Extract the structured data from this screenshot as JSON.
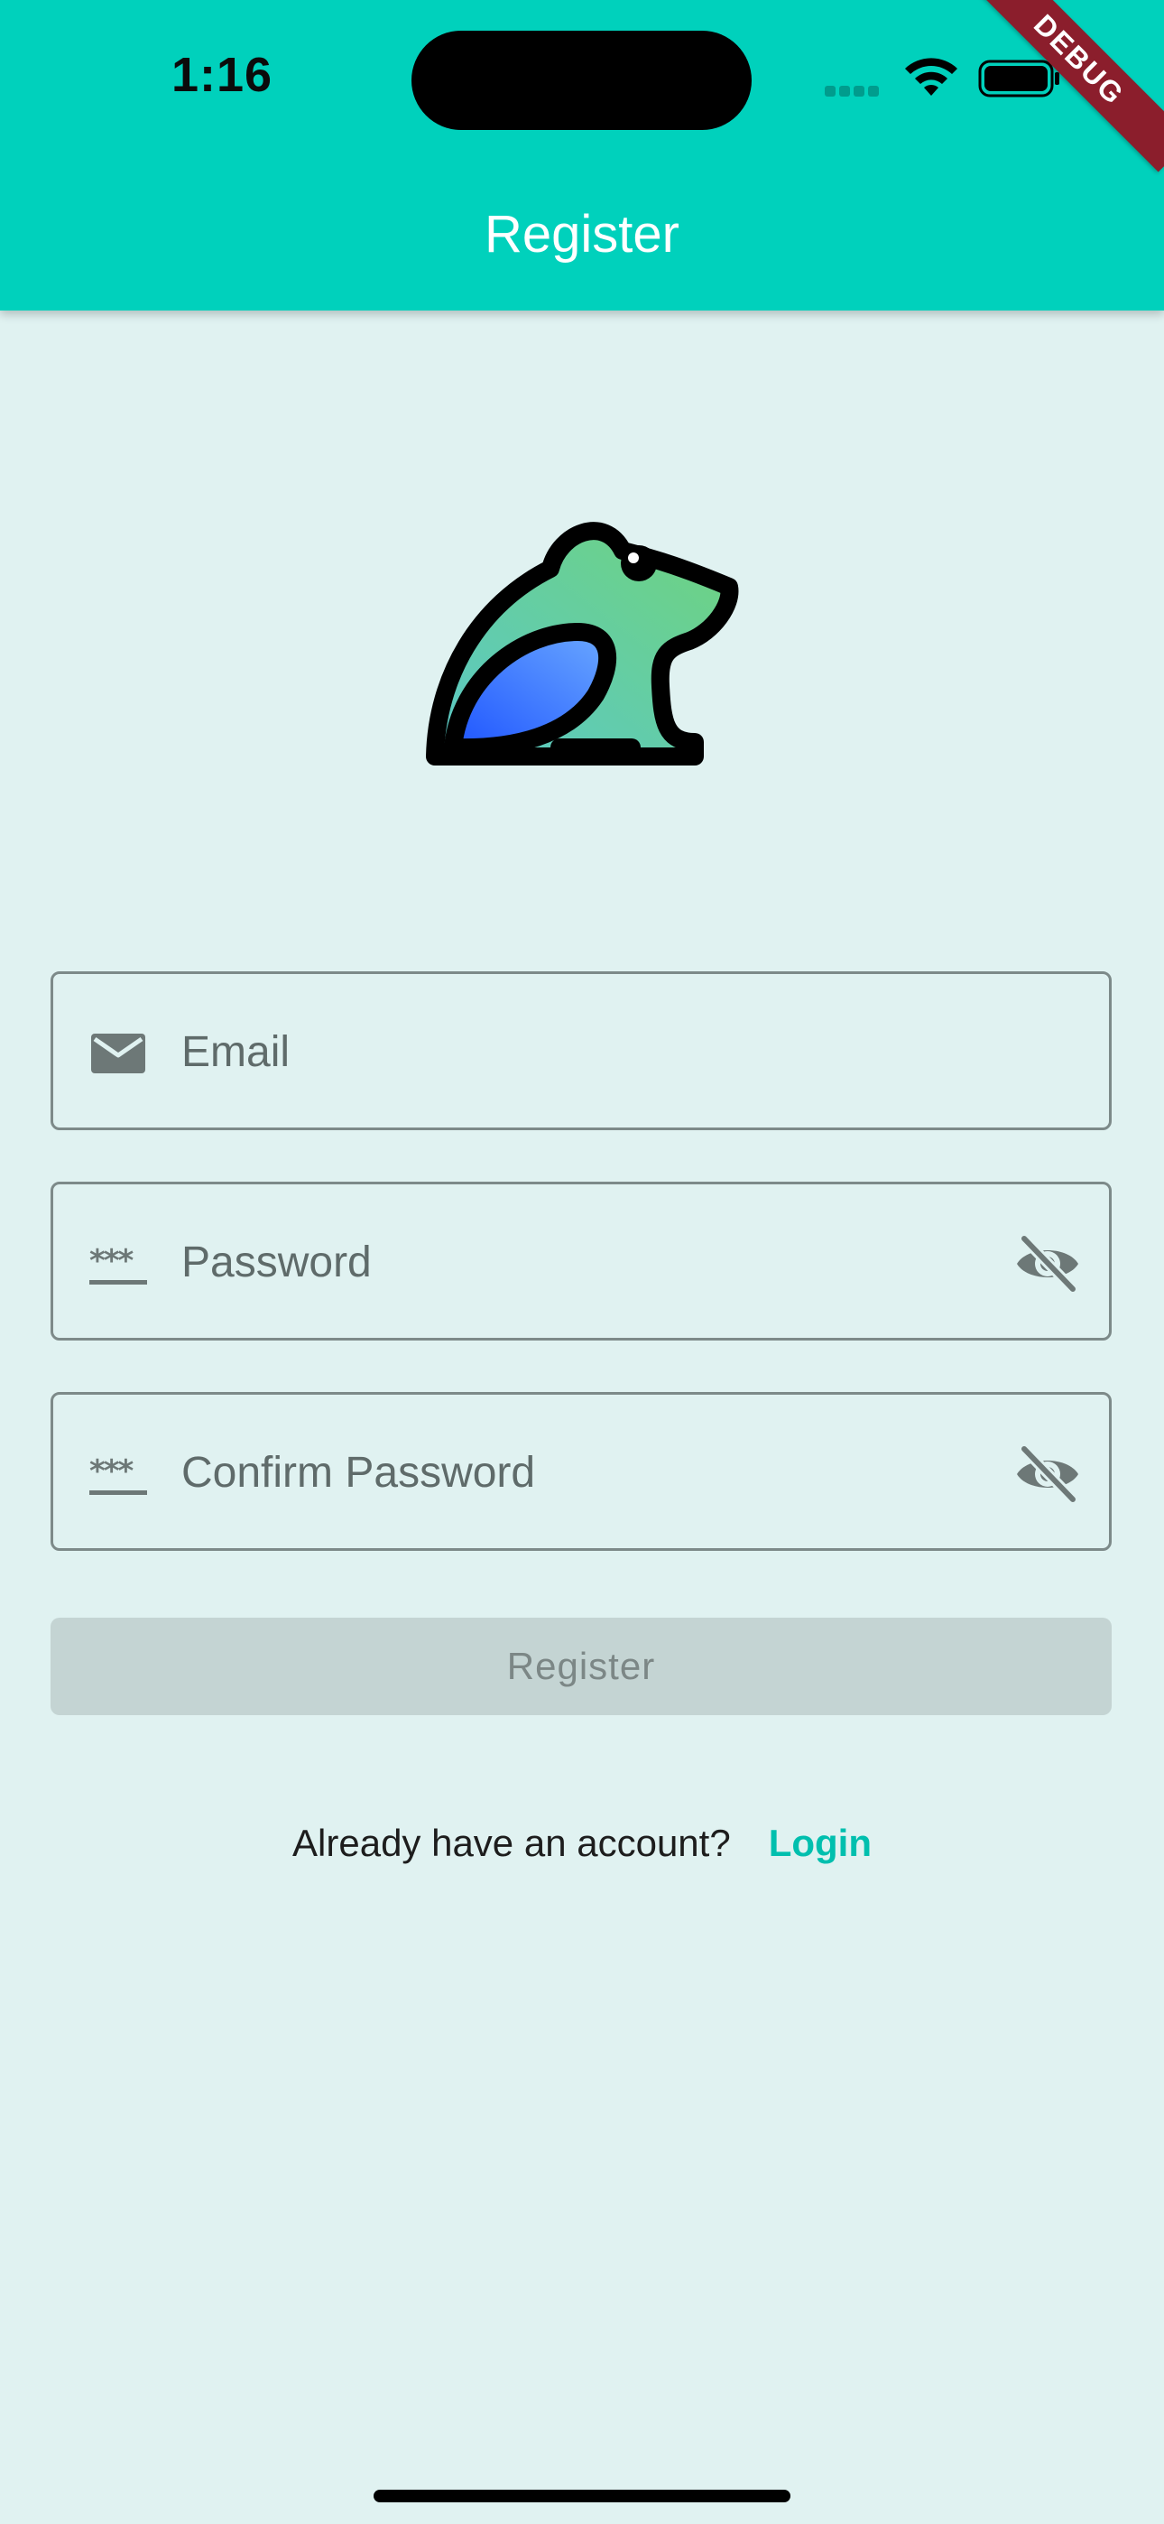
{
  "status_bar": {
    "time": "1:16"
  },
  "app_bar": {
    "title": "Register",
    "debug_label": "DEBUG"
  },
  "logo": {
    "icon": "frog-logo",
    "colors": {
      "body_top": "#6fd37e",
      "body_bottom": "#5ac8c8",
      "leg": "#2a6cff",
      "outline": "#000000"
    }
  },
  "form": {
    "email": {
      "placeholder": "Email",
      "value": "",
      "icon": "mail-icon"
    },
    "password": {
      "placeholder": "Password",
      "value": "",
      "icon": "password-icon",
      "toggle_icon": "visibility-off-icon"
    },
    "confirm_password": {
      "placeholder": "Confirm Password",
      "value": "",
      "icon": "password-icon",
      "toggle_icon": "visibility-off-icon"
    },
    "submit_label": "Register"
  },
  "footer": {
    "prompt": "Already have an account?",
    "link_label": "Login"
  },
  "colors": {
    "primary": "#00d1bc",
    "background": "#e0f2f1",
    "link": "#00bfae",
    "disabled_button": "#c4d4d3"
  }
}
